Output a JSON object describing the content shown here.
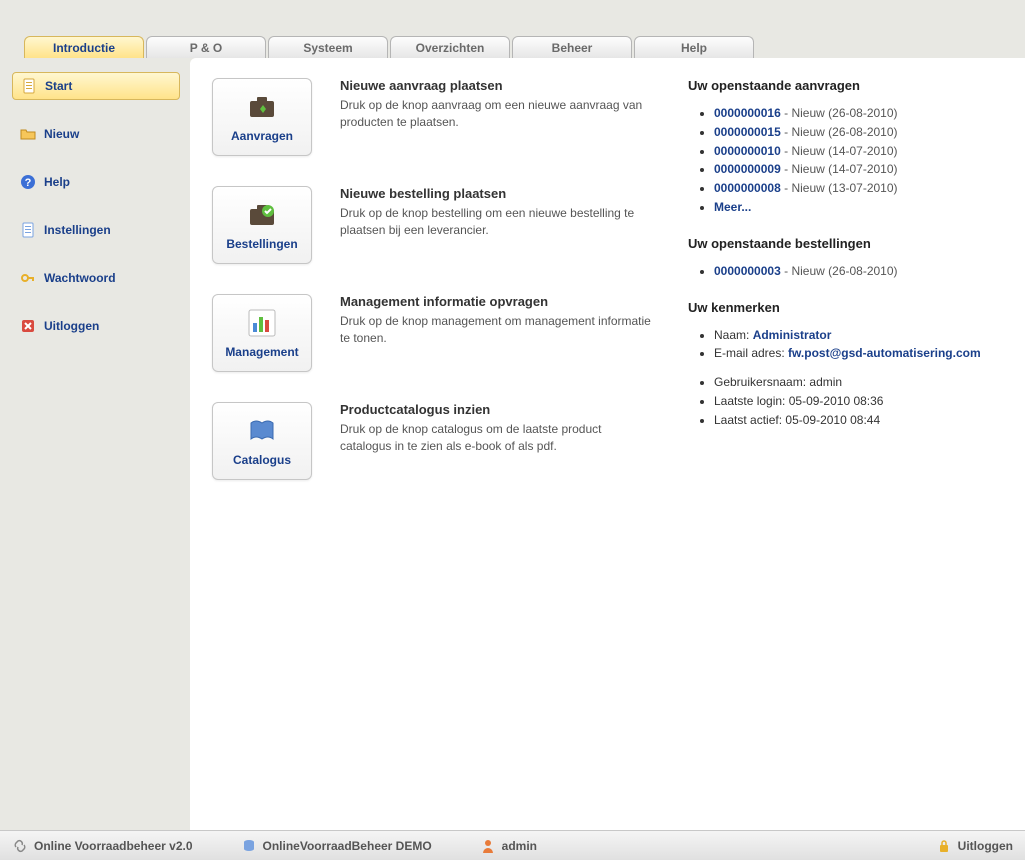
{
  "tabs": [
    {
      "label": "Introductie",
      "active": true
    },
    {
      "label": "P & O"
    },
    {
      "label": "Systeem"
    },
    {
      "label": "Overzichten"
    },
    {
      "label": "Beheer"
    },
    {
      "label": "Help"
    }
  ],
  "sidebar": [
    {
      "label": "Start",
      "icon": "document",
      "active": true
    },
    {
      "label": "Nieuw",
      "icon": "folder-open"
    },
    {
      "label": "Help",
      "icon": "help"
    },
    {
      "label": "Instellingen",
      "icon": "settings-doc"
    },
    {
      "label": "Wachtwoord",
      "icon": "key"
    },
    {
      "label": "Uitloggen",
      "icon": "close"
    }
  ],
  "tiles": [
    {
      "label": "Aanvragen",
      "title": "Nieuwe aanvraag plaatsen",
      "desc": "Druk op de knop aanvraag om een nieuwe aanvraag van producten te plaatsen.",
      "icon": "briefcase-arrow"
    },
    {
      "label": "Bestellingen",
      "title": "Nieuwe bestelling plaatsen",
      "desc": "Druk op de knop bestelling om een nieuwe bestelling te plaatsen bij een leverancier.",
      "icon": "briefcase-check"
    },
    {
      "label": "Management",
      "title": "Management informatie opvragen",
      "desc": "Druk op de knop management om management informatie te tonen.",
      "icon": "bar-chart"
    },
    {
      "label": "Catalogus",
      "title": "Productcatalogus inzien",
      "desc": "Druk op de knop catalogus om de laatste product catalogus in te zien als e-book of als pdf.",
      "icon": "book"
    }
  ],
  "right": {
    "requests_title": "Uw openstaande aanvragen",
    "requests": [
      {
        "id": "0000000016",
        "status": "Nieuw",
        "date": "26-08-2010"
      },
      {
        "id": "0000000015",
        "status": "Nieuw",
        "date": "26-08-2010"
      },
      {
        "id": "0000000010",
        "status": "Nieuw",
        "date": "14-07-2010"
      },
      {
        "id": "0000000009",
        "status": "Nieuw",
        "date": "14-07-2010"
      },
      {
        "id": "0000000008",
        "status": "Nieuw",
        "date": "13-07-2010"
      }
    ],
    "more_label": "Meer...",
    "orders_title": "Uw openstaande bestellingen",
    "orders": [
      {
        "id": "0000000003",
        "status": "Nieuw",
        "date": "26-08-2010"
      }
    ],
    "attrs_title": "Uw kenmerken",
    "name_label": "Naam:",
    "name_value": "Administrator",
    "email_label": "E-mail adres:",
    "email_value": "fw.post@gsd-automatisering.com",
    "username_label": "Gebruikersnaam:",
    "username_value": "admin",
    "lastlogin_label": "Laatste login:",
    "lastlogin_value": "05-09-2010 08:36",
    "lastactive_label": "Laatst actief:",
    "lastactive_value": "05-09-2010 08:44"
  },
  "footer": {
    "app_name": "Online Voorraadbeheer v2.0",
    "db_name": "OnlineVoorraadBeheer DEMO",
    "user": "admin",
    "logout": "Uitloggen"
  }
}
